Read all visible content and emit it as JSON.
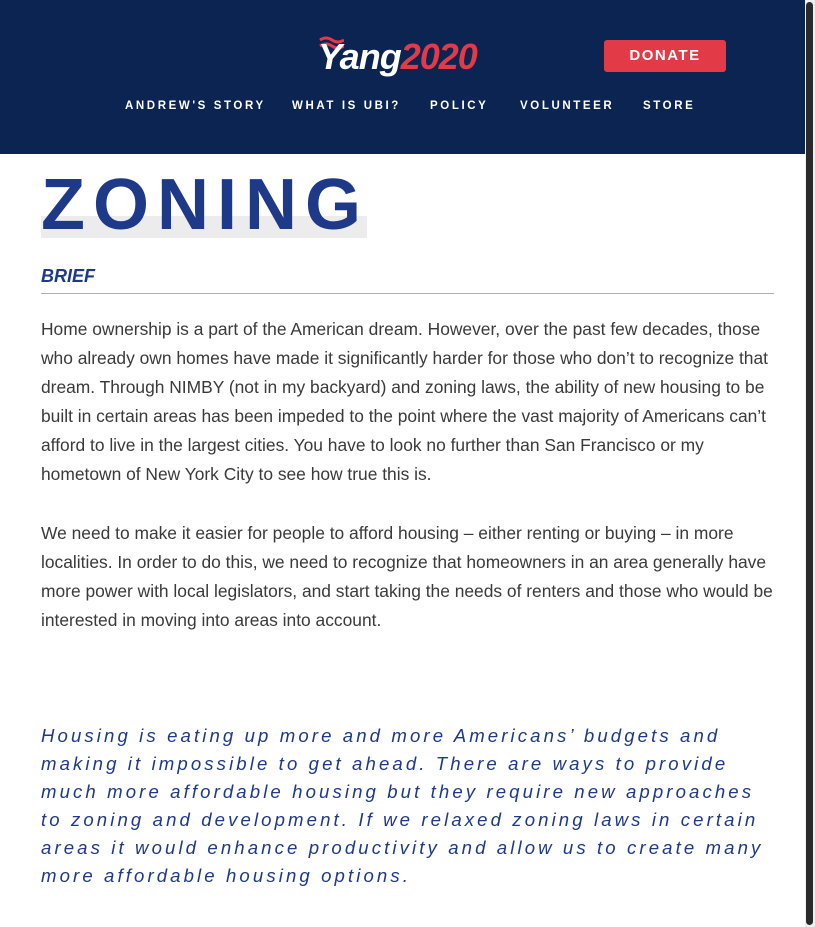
{
  "header": {
    "logo": {
      "name": "Yang",
      "year": "2020",
      "alt": "Yang2020"
    },
    "donate_label": "DONATE",
    "nav": [
      {
        "label": "ANDREW'S STORY"
      },
      {
        "label": "WHAT IS UBI?"
      },
      {
        "label": "POLICY"
      },
      {
        "label": "VOLUNTEER"
      },
      {
        "label": "STORE"
      }
    ]
  },
  "page": {
    "title": "ZONING",
    "section_label": "BRIEF",
    "paragraphs": [
      "Home ownership is a part of the American dream. However, over the past few decades, those who already own homes have made it significantly harder for those who don’t to recognize that dream. Through NIMBY (not in my backyard) and zoning laws, the ability of new housing to be built in certain areas has been impeded to the point where the vast majority of Americans can’t afford to live in the largest cities. You have to look no further than San Francisco or my hometown of New York City to see how true this is.",
      "We need to make it easier for people to afford housing – either renting or buying – in more localities. In order to do this, we need to recognize that homeowners in an area generally have more power with local legislators, and start taking the needs of renters and those who would be interested in moving into areas into account."
    ],
    "quote": "Housing is eating up more and more Americans’ budgets and making it impossible to get ahead. There are ways to provide much more affordable housing but they require new approaches to zoning and development. If we relaxed zoning laws in certain areas it would enhance productivity and allow us to create many more affordable housing options."
  },
  "colors": {
    "header_bg": "#0b2451",
    "accent_red": "#e23a47",
    "title_blue": "#1f3989",
    "body_text": "#3a3a3a"
  },
  "icons": [
    "flag-logo-icon"
  ]
}
